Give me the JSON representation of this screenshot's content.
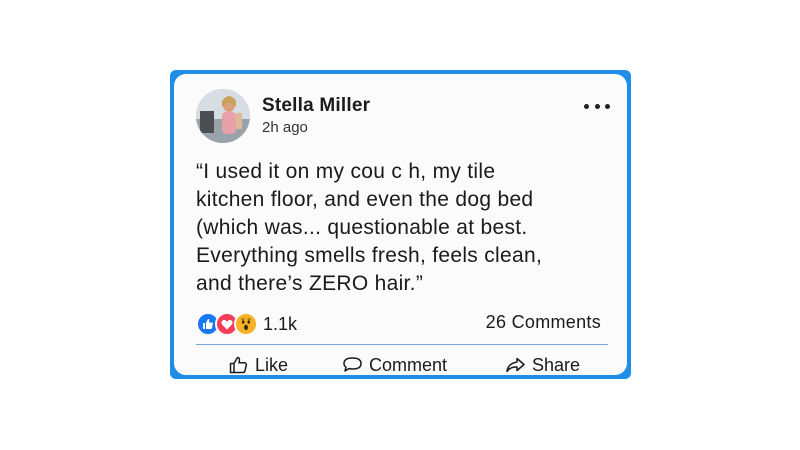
{
  "post": {
    "author": "Stella Miller",
    "time": "2h ago",
    "text_lines": [
      "“I used it on my cou c h, my tile",
      "kitchen floor, and even the dog bed",
      "(which was... questionable at best.",
      "Everything smells fresh, feels clean,",
      "and there’s ZERO hair.”"
    ],
    "reactions": {
      "icons": [
        "like-icon",
        "love-icon",
        "wow-icon"
      ],
      "count": "1.1k"
    },
    "comments_label": "26 Comments"
  },
  "actions": {
    "like": "Like",
    "comment": "Comment",
    "share": "Share"
  },
  "colors": {
    "frame": "#1e8ee6",
    "like": "#1877f2",
    "love": "#f33e58",
    "wow": "#f7b125"
  }
}
